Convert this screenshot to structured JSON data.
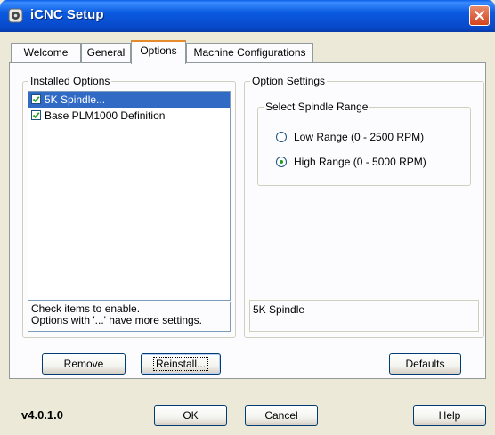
{
  "window": {
    "title": "iCNC Setup"
  },
  "tabs": [
    {
      "label": "Welcome"
    },
    {
      "label": "General"
    },
    {
      "label": "Options",
      "active": true
    },
    {
      "label": "Machine Configurations"
    }
  ],
  "installed_options": {
    "title": "Installed Options",
    "items": [
      {
        "label": "5K Spindle...",
        "checked": true,
        "selected": true
      },
      {
        "label": "Base PLM1000 Definition",
        "checked": true,
        "selected": false
      }
    ],
    "hint_line1": "Check items to enable.",
    "hint_line2": "Options with '...' have more settings."
  },
  "option_settings": {
    "title": "Option Settings",
    "spindle_group_title": "Select Spindle Range",
    "radios": [
      {
        "label": "Low Range (0 - 2500 RPM)",
        "selected": false
      },
      {
        "label": "High Range (0 - 5000 RPM)",
        "selected": true
      }
    ],
    "description": "5K Spindle"
  },
  "buttons": {
    "remove": "Remove",
    "reinstall": "Reinstall...",
    "defaults": "Defaults",
    "ok": "OK",
    "cancel": "Cancel",
    "help": "Help"
  },
  "version": "v4.0.1.0",
  "colors": {
    "titlebar": "#0a5ae0",
    "selection": "#316ac5",
    "active_tab_accent": "#e68b2c",
    "radio_dot": "#21a121"
  }
}
